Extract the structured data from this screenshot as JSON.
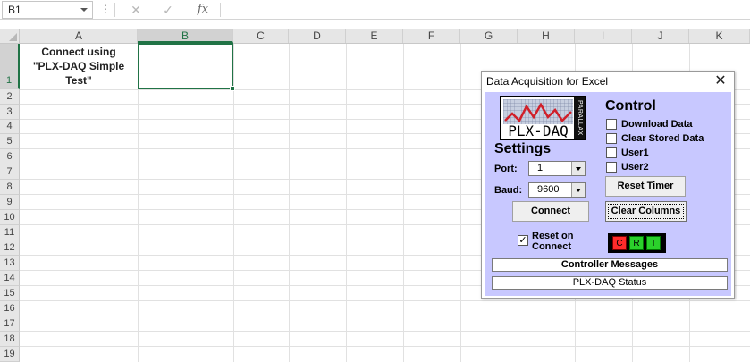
{
  "formula_bar": {
    "name_box": "B1",
    "menu_glyph": "⋮",
    "cancel_glyph": "✕",
    "enter_glyph": "✓",
    "fx_label": "fx",
    "formula": ""
  },
  "grid": {
    "columns": [
      "A",
      "B",
      "C",
      "D",
      "E",
      "F",
      "G",
      "H",
      "I",
      "J",
      "K"
    ],
    "selected_column": "B",
    "rows": [
      "1",
      "2",
      "3",
      "4",
      "5",
      "6",
      "7",
      "8",
      "9",
      "10",
      "11",
      "12",
      "13",
      "14",
      "15",
      "16",
      "17",
      "18",
      "19"
    ],
    "selected_row": "1",
    "cell_a1": [
      "Connect using",
      "\"PLX-DAQ Simple",
      "Test\""
    ],
    "cell_b1": ""
  },
  "dialog": {
    "title": "Data Acquisition for Excel",
    "close_glyph": "✕",
    "logo_text": "PLX-DAQ",
    "logo_vertical": "PARALLAX",
    "settings": {
      "title": "Settings",
      "port_label": "Port:",
      "port_value": "1",
      "baud_label": "Baud:",
      "baud_value": "9600",
      "connect_label": "Connect",
      "reset_on_connect_label": [
        "Reset on",
        "Connect"
      ],
      "reset_on_connect_checked": true
    },
    "control": {
      "title": "Control",
      "checkboxes": [
        {
          "label": "Download Data",
          "checked": false
        },
        {
          "label": "Clear Stored Data",
          "checked": false
        },
        {
          "label": "User1",
          "checked": false
        },
        {
          "label": "User2",
          "checked": false
        }
      ],
      "reset_timer_label": "Reset Timer",
      "clear_columns_label": "Clear Columns"
    },
    "leds": [
      "C",
      "R",
      "T"
    ],
    "controller_messages": "Controller Messages",
    "status": "PLX-DAQ Status"
  },
  "colors": {
    "excel_green": "#217346",
    "dialog_body": "#c8c8ff",
    "led_red": "#ff2b2b",
    "led_green": "#2bd12b"
  }
}
